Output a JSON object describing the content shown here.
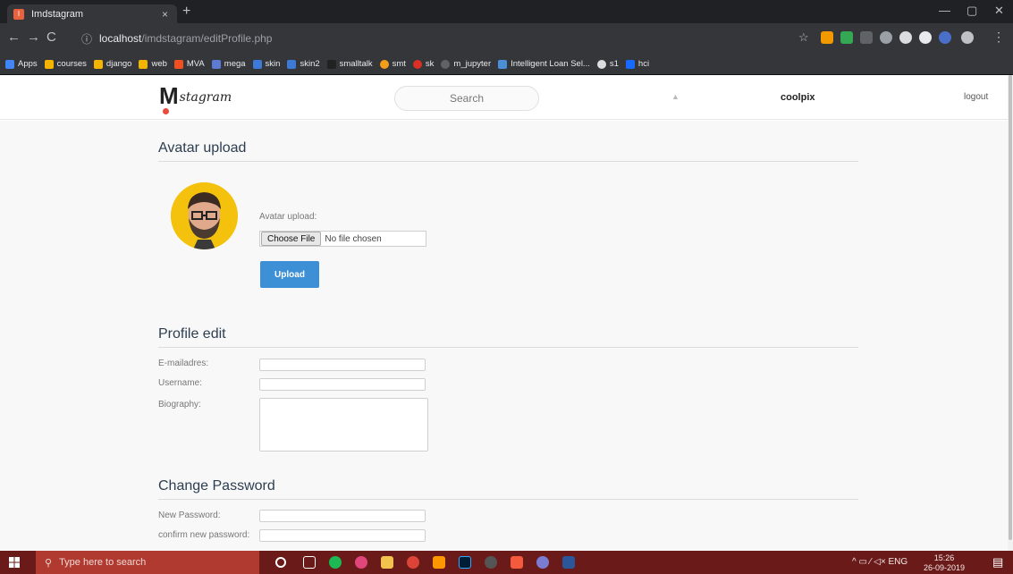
{
  "browser": {
    "tab_title": "Imdstagram",
    "tab_close": "×",
    "new_tab": "+",
    "url_host": "localhost",
    "url_path": "/imdstagram/editProfile.php"
  },
  "bookmarks": [
    {
      "label": "Apps",
      "color": "#4285f4"
    },
    {
      "label": "courses",
      "color": "#f4b400"
    },
    {
      "label": "django",
      "color": "#f4b400"
    },
    {
      "label": "web",
      "color": "#f4b400"
    },
    {
      "label": "MVA",
      "color": "#f25022"
    },
    {
      "label": "mega",
      "color": "#5b7bd5"
    },
    {
      "label": "skin",
      "color": "#3d7ad8"
    },
    {
      "label": "skin2",
      "color": "#3d7ad8"
    },
    {
      "label": "smalltalk",
      "color": "#222222"
    },
    {
      "label": "smt",
      "color": "#f59c1a"
    },
    {
      "label": "sk",
      "color": "#d93025"
    },
    {
      "label": "m_jupyter",
      "color": "#5f6368"
    },
    {
      "label": "Intelligent Loan Sel...",
      "color": "#4a90d9"
    },
    {
      "label": "s1",
      "color": "#dddddd"
    },
    {
      "label": "hci",
      "color": "#1769ff"
    }
  ],
  "app": {
    "search_placeholder": "Search",
    "username": "coolpix",
    "logout": "logout",
    "bell": "▲"
  },
  "avatar_section": {
    "title": "Avatar upload",
    "field_label": "Avatar upload:",
    "choose_file": "Choose File",
    "no_file": "No file chosen",
    "upload_button": "Upload"
  },
  "profile_section": {
    "title": "Profile edit",
    "email_label": "E-mailadres:",
    "email_value": "",
    "username_label": "Username:",
    "username_value": "",
    "bio_label": "Biography:",
    "bio_value": ""
  },
  "password_section": {
    "title": "Change Password",
    "new_label": "New Password:",
    "confirm_label": "confirm new password:"
  },
  "taskbar": {
    "search_placeholder": "Type here to search",
    "tray": "^ ▭ ⁄ ◁× ENG",
    "time": "15:26",
    "date": "26-09-2019"
  }
}
